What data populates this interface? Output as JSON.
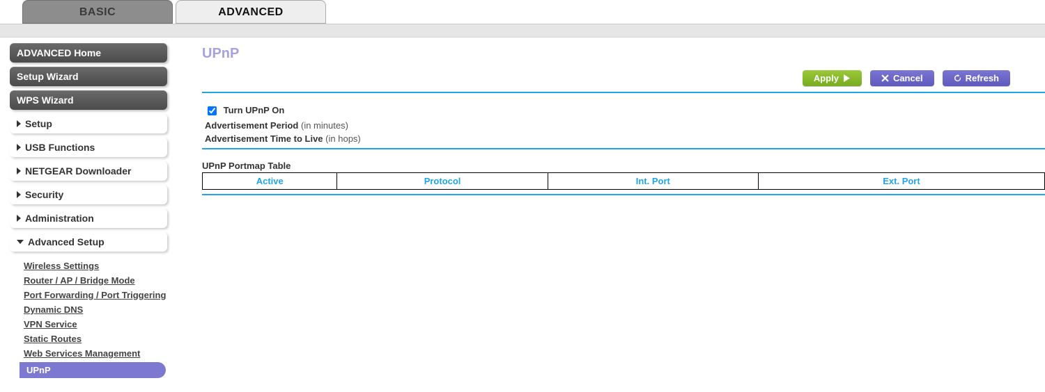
{
  "tabs": {
    "basic": "BASIC",
    "advanced": "ADVANCED"
  },
  "sidebar": {
    "pills": [
      "ADVANCED Home",
      "Setup Wizard",
      "WPS Wizard"
    ],
    "items": [
      "Setup",
      "USB Functions",
      "NETGEAR Downloader",
      "Security",
      "Administration",
      "Advanced Setup"
    ],
    "sub": [
      "Wireless Settings",
      "Router / AP / Bridge Mode",
      "Port Forwarding / Port Triggering",
      "Dynamic DNS",
      "VPN Service",
      "Static Routes",
      "Web Services Management",
      "UPnP"
    ]
  },
  "buttons": {
    "apply": "Apply",
    "cancel": "Cancel",
    "refresh": "Refresh"
  },
  "page": {
    "title": "UPnP",
    "turn_on_label": "Turn UPnP On",
    "turn_on_checked": true,
    "ad_period_label": "Advertisement Period",
    "ad_period_unit": "(in minutes)",
    "ad_ttl_label": "Advertisement Time to Live",
    "ad_ttl_unit": "(in hops)",
    "table_title": "UPnP Portmap Table",
    "columns": [
      "Active",
      "Protocol",
      "Int. Port",
      "Ext. Port"
    ]
  }
}
